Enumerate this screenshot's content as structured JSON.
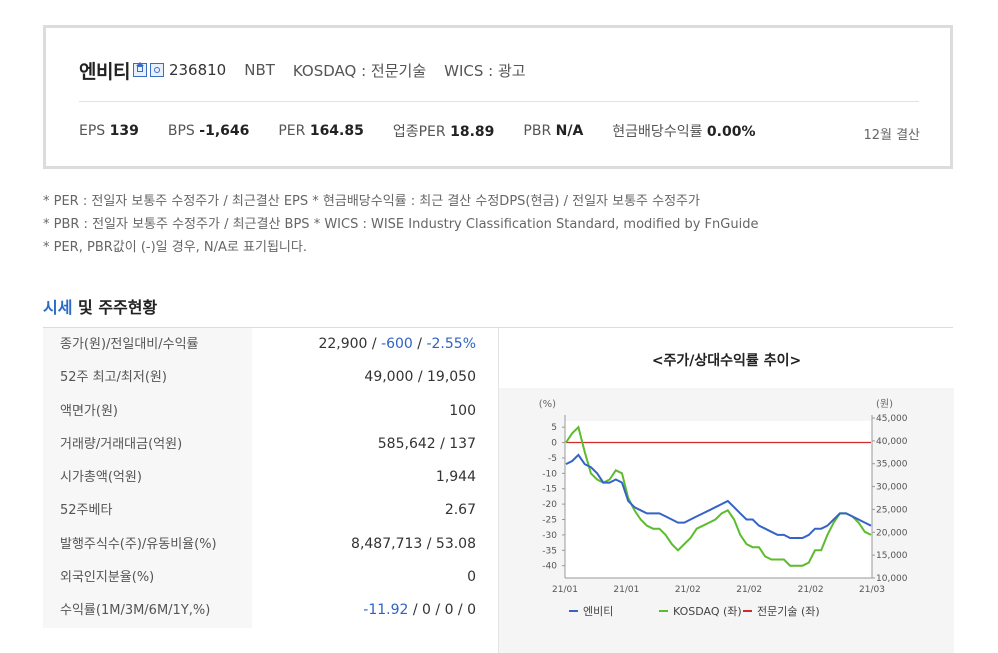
{
  "company": {
    "name": "엔비티",
    "code": "236810",
    "ticker": "NBT",
    "market": "KOSDAQ : 전문기술",
    "wics": "WICS : 광고"
  },
  "metrics": [
    {
      "label": "EPS",
      "value": "139"
    },
    {
      "label": "BPS",
      "value": "-1,646"
    },
    {
      "label": "PER",
      "value": "164.85"
    },
    {
      "label": "업종PER",
      "value": "18.89"
    },
    {
      "label": "PBR",
      "value": "N/A"
    },
    {
      "label": "현금배당수익률",
      "value": "0.00%"
    }
  ],
  "fiscal": "12월 결산",
  "notes": [
    "* PER : 전일자 보통주 수정주가 / 최근결산 EPS * 현금배당수익률 : 최근 결산 수정DPS(현금) / 전일자 보통주 수정주가",
    "* PBR : 전일자 보통주 수정주가 / 최근결산 BPS * WICS : WISE Industry Classification Standard, modified by FnGuide",
    "* PER, PBR값이 (-)일 경우, N/A로 표기됩니다."
  ],
  "section": {
    "accent": "시세",
    "rest": " 및 주주현황"
  },
  "price_table": [
    {
      "label": "종가(원)/전일대비/수익률",
      "value": "22,900",
      "v2": "-600",
      "v3": "-2.55%"
    },
    {
      "label": "52주 최고/최저(원)",
      "value": "49,000 / 19,050"
    },
    {
      "label": "액면가(원)",
      "value": "100"
    },
    {
      "label": "거래량/거래대금(억원)",
      "value": "585,642 / 137"
    },
    {
      "label": "시가총액(억원)",
      "value": "1,944"
    },
    {
      "label": "52주베타",
      "value": "2.67"
    },
    {
      "label": "발행주식수(주)/유동비율(%)",
      "value": "8,487,713 / 53.08"
    },
    {
      "label": "외국인지분율(%)",
      "value": "0"
    },
    {
      "label": "수익률(1M/3M/6M/1Y,%)",
      "v1": "-11.92",
      "value": " / 0 / 0 / 0"
    }
  ],
  "chart_title": "<주가/상대수익률 추이>",
  "chart_data": {
    "type": "line",
    "left_axis_unit": "(%)",
    "right_axis_unit": "(원)",
    "left_ticks": [
      5,
      0,
      -5,
      -10,
      -15,
      -20,
      -25,
      -30,
      -35,
      -40
    ],
    "right_ticks": [
      "45,000",
      "40,000",
      "35,000",
      "30,000",
      "25,000",
      "20,000",
      "15,000",
      "10,000"
    ],
    "x_labels": [
      "21/01",
      "21/01",
      "21/02",
      "21/02",
      "21/02",
      "21/03"
    ],
    "ylim_left": [
      -44,
      7
    ],
    "series": [
      {
        "name": "엔비티",
        "color": "#3563c8",
        "values": [
          -7,
          -6,
          -4,
          -7,
          -8,
          -10,
          -13,
          -13,
          -12,
          -13,
          -19,
          -21,
          -22,
          -23,
          -23,
          -23,
          -24,
          -25,
          -26,
          -26,
          -25,
          -24,
          -23,
          -22,
          -21,
          -20,
          -19,
          -21,
          -23,
          -25,
          -25,
          -27,
          -28,
          -29,
          -30,
          -30,
          -31,
          -31,
          -31,
          -30,
          -28,
          -28,
          -27,
          -25,
          -23,
          -23,
          -24,
          -25,
          -26,
          -27
        ]
      },
      {
        "name": "KOSDAQ (좌)",
        "color": "#5cbc2e",
        "values": [
          0,
          3,
          5,
          -3,
          -10,
          -12,
          -13,
          -12,
          -9,
          -10,
          -18,
          -22,
          -25,
          -27,
          -28,
          -28,
          -30,
          -33,
          -35,
          -33,
          -31,
          -28,
          -27,
          -26,
          -25,
          -23,
          -22,
          -25,
          -30,
          -33,
          -34,
          -34,
          -37,
          -38,
          -38,
          -38,
          -40,
          -40,
          -40,
          -39,
          -35,
          -35,
          -30,
          -26,
          -23,
          -23,
          -24,
          -26,
          -29,
          -30
        ]
      },
      {
        "name": "전문기술 (좌)",
        "color": "#d02a2a",
        "values": [
          0,
          0,
          0,
          0,
          0,
          0,
          0,
          0,
          0,
          0,
          0,
          0,
          0,
          0,
          0,
          0,
          0,
          0,
          0,
          0,
          0,
          0,
          0,
          0,
          0,
          0,
          0,
          0,
          0,
          0,
          0,
          0,
          0,
          0,
          0,
          0,
          0,
          0,
          0,
          0,
          0,
          0,
          0,
          0,
          0,
          0,
          0,
          0,
          0,
          0
        ]
      }
    ]
  }
}
